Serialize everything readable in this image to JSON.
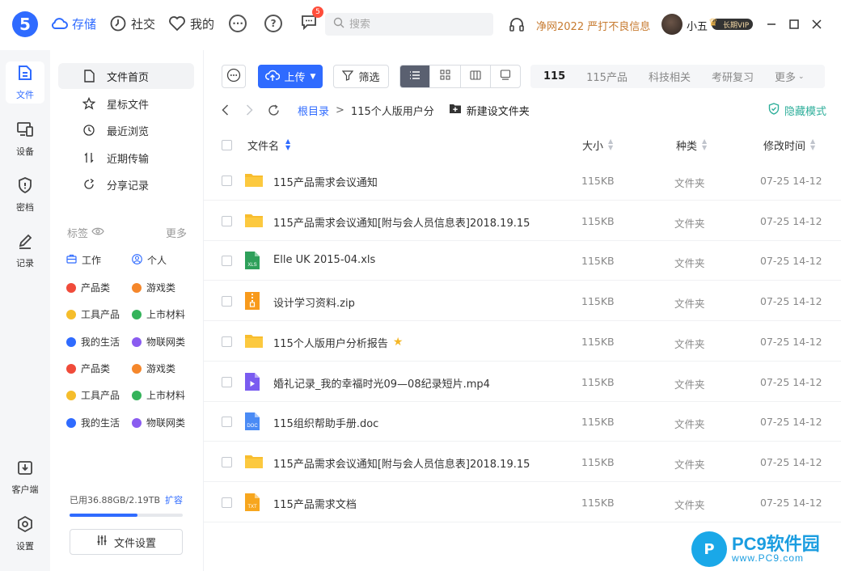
{
  "app": {
    "logo_text": "5"
  },
  "topnav": {
    "items": [
      {
        "label": "存储",
        "icon": "cloud-icon"
      },
      {
        "label": "社交",
        "icon": "clock-icon"
      },
      {
        "label": "我的",
        "icon": "heart-icon"
      }
    ],
    "message_badge": "5",
    "search_placeholder": "搜索",
    "promo": "净网2022 严打不良信息",
    "username": "小五",
    "vip_label": "长期VIP"
  },
  "rail": {
    "items": [
      {
        "label": "文件",
        "icon": "file-icon"
      },
      {
        "label": "设备",
        "icon": "device-icon"
      },
      {
        "label": "密档",
        "icon": "shield-icon"
      },
      {
        "label": "记录",
        "icon": "pen-icon"
      },
      {
        "label": "客户端",
        "icon": "download-icon"
      },
      {
        "label": "设置",
        "icon": "settings-icon"
      }
    ]
  },
  "sidebar": {
    "items": [
      {
        "label": "文件首页",
        "icon": "document-icon"
      },
      {
        "label": "星标文件",
        "icon": "star-icon"
      },
      {
        "label": "最近浏览",
        "icon": "history-icon"
      },
      {
        "label": "近期传输",
        "icon": "transfer-icon"
      },
      {
        "label": "分享记录",
        "icon": "share-icon"
      }
    ],
    "tags_title": "标签",
    "tags_more": "更多",
    "tags": [
      {
        "label": "工作",
        "kind": "briefcase"
      },
      {
        "label": "个人",
        "kind": "person"
      },
      {
        "label": "产品类",
        "color": "#f04b3a"
      },
      {
        "label": "游戏类",
        "color": "#f5872b"
      },
      {
        "label": "工具产品",
        "color": "#f5bd2b"
      },
      {
        "label": "上市材料",
        "color": "#34b35a"
      },
      {
        "label": "我的生活",
        "color": "#2f6bff"
      },
      {
        "label": "物联网类",
        "color": "#8a5cf0"
      },
      {
        "label": "产品类",
        "color": "#f04b3a"
      },
      {
        "label": "游戏类",
        "color": "#f5872b"
      },
      {
        "label": "工具产品",
        "color": "#f5bd2b"
      },
      {
        "label": "上市材料",
        "color": "#34b35a"
      },
      {
        "label": "我的生活",
        "color": "#2f6bff"
      },
      {
        "label": "物联网类",
        "color": "#8a5cf0"
      }
    ],
    "usage": "已用36.88GB/2.19TB",
    "usage_fraction": 0.6,
    "expand": "扩容",
    "file_settings": "文件设置"
  },
  "toolbar": {
    "upload": "上传",
    "filter": "筛选",
    "quick_tabs": [
      "115",
      "115产品",
      "科技相关",
      "考研复习",
      "更多"
    ]
  },
  "breadcrumb": {
    "root": "根目录",
    "current": "115个人版用户分",
    "new_folder": "新建设文件夹",
    "hide_mode": "隐藏模式"
  },
  "table": {
    "columns": [
      "文件名",
      "大小",
      "种类",
      "修改时间"
    ],
    "rows": [
      {
        "name": "115产品需求会议通知",
        "icon": "folder",
        "size": "115KB",
        "kind": "文件夹",
        "time": "07-25 14-12"
      },
      {
        "name": "115产品需求会议通知[附与会人员信息表]2018.19.15",
        "icon": "folder",
        "size": "115KB",
        "kind": "文件夹",
        "time": "07-25 14-12"
      },
      {
        "name": "Elle UK 2015-04.xls",
        "icon": "xls",
        "size": "115KB",
        "kind": "文件夹",
        "time": "07-25 14-12"
      },
      {
        "name": "设计学习资料.zip",
        "icon": "zip",
        "size": "115KB",
        "kind": "文件夹",
        "time": "07-25 14-12"
      },
      {
        "name": "115个人版用户分析报告",
        "icon": "folder",
        "size": "115KB",
        "kind": "文件夹",
        "time": "07-25 14-12",
        "starred": true
      },
      {
        "name": "婚礼记录_我的幸福时光09—08纪录短片.mp4",
        "icon": "video",
        "size": "115KB",
        "kind": "文件夹",
        "time": "07-25 14-12"
      },
      {
        "name": "115组织帮助手册.doc",
        "icon": "doc",
        "size": "115KB",
        "kind": "文件夹",
        "time": "07-25 14-12"
      },
      {
        "name": "115产品需求会议通知[附与会人员信息表]2018.19.15",
        "icon": "folder",
        "size": "115KB",
        "kind": "文件夹",
        "time": "07-25 14-12"
      },
      {
        "name": "115产品需求文档",
        "icon": "txt",
        "size": "115KB",
        "kind": "文件夹",
        "time": "07-25 14-12"
      }
    ]
  },
  "watermark": {
    "title": "PC9软件园",
    "url": "www.PC9.com",
    "logo_text": "P"
  }
}
